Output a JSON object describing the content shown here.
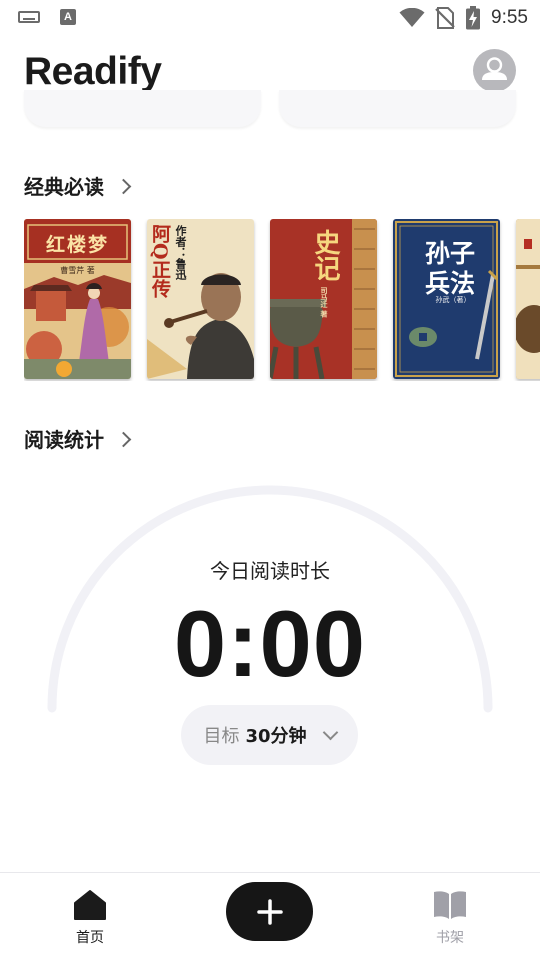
{
  "status_bar": {
    "time": "9:55",
    "icons": [
      "keyboard-icon",
      "a-notification-icon",
      "wifi-icon",
      "no-sim-icon",
      "battery-charging-icon"
    ],
    "a_icon_text": "A"
  },
  "header": {
    "app_title": "Readify",
    "avatar_icon": "user-avatar-icon"
  },
  "classics": {
    "title": "经典必读",
    "books": [
      {
        "title": "红楼梦",
        "author": "曹雪芹 著",
        "bg": "#c9a56b"
      },
      {
        "title": "阿Q正传",
        "author": "作者：鲁迅",
        "bg": "#efe3c6"
      },
      {
        "title": "史记",
        "author": "司马迁 著",
        "bg": "#a83226"
      },
      {
        "title": "孙子兵法",
        "author": "孙武（著）",
        "bg": "#1f3b6e"
      },
      {
        "title": "",
        "author": "",
        "bg": "#c79a4e"
      }
    ]
  },
  "reading_stats": {
    "title": "阅读统计",
    "today_label": "今日阅读时长",
    "today_time": "0:00",
    "goal_label": "目标",
    "goal_value": "30分钟",
    "progress": 0
  },
  "bottom_nav": {
    "home_label": "首页",
    "shelf_label": "书架",
    "add_icon": "plus-icon",
    "active_color": "#1b1b1b",
    "inactive_color": "#a0a0a8"
  }
}
